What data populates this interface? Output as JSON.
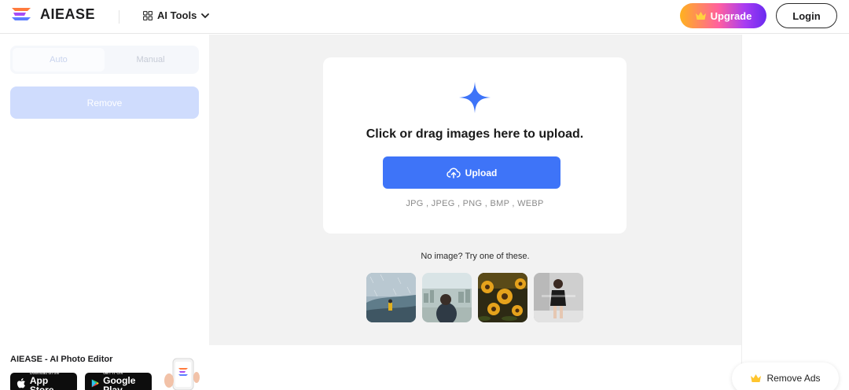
{
  "header": {
    "logo_text": "AIEASE",
    "tools_label": "AI Tools",
    "upgrade_label": "Upgrade",
    "login_label": "Login"
  },
  "sidebar": {
    "tabs": [
      {
        "label": "Auto",
        "active": true
      },
      {
        "label": "Manual",
        "active": false
      }
    ],
    "remove_label": "Remove",
    "promo_title": "AIEASE - AI Photo Editor",
    "app_store": {
      "small": "Download on the",
      "big": "App Store"
    },
    "google_play": {
      "small": "GET IT ON",
      "big": "Google Play"
    }
  },
  "upload": {
    "title": "Click or drag images here to upload.",
    "button_label": "Upload",
    "formats": "JPG , JPEG , PNG , BMP , WEBP",
    "samples_text": "No image? Try one of these."
  },
  "samples": [
    {
      "name": "sample-foggy-sea"
    },
    {
      "name": "sample-person-city"
    },
    {
      "name": "sample-sunflowers"
    },
    {
      "name": "sample-woman-sitting"
    }
  ],
  "remove_ads_label": "Remove Ads",
  "colors": {
    "accent": "#3e74f8",
    "remove_disabled": "#cfdcfd",
    "main_bg": "#f2f2f2"
  }
}
